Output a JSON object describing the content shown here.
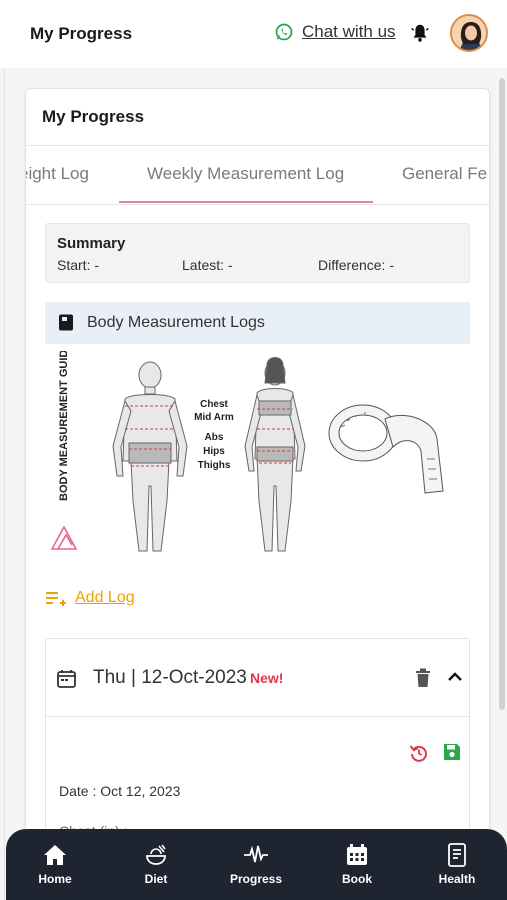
{
  "header": {
    "title": "My Progress",
    "chat_label": "Chat with us"
  },
  "card": {
    "title": "My Progress",
    "tabs": [
      {
        "label": "eight Log"
      },
      {
        "label": "Weekly Measurement Log",
        "active": true
      },
      {
        "label": "General Fe"
      }
    ]
  },
  "summary": {
    "title": "Summary",
    "start": "Start: -",
    "latest": "Latest: -",
    "difference": "Difference: -"
  },
  "logs_section": {
    "title": "Body Measurement Logs"
  },
  "guide_image": {
    "vertical_title": "BODY MEASUREMENT GUIDE",
    "labels": [
      "Chest",
      "Mid Arm",
      "Abs",
      "Hips",
      "Thighs"
    ]
  },
  "add_log": {
    "label": "Add Log"
  },
  "entry": {
    "date_header": "Thu | 12-Oct-2023",
    "badge": "New!",
    "date_line": "Date : Oct 12, 2023",
    "partial_line": "Chest (in) :"
  },
  "bottom_nav": [
    {
      "label": "Home",
      "icon": "home-icon"
    },
    {
      "label": "Diet",
      "icon": "diet-icon"
    },
    {
      "label": "Progress",
      "icon": "pulse-icon"
    },
    {
      "label": "Book",
      "icon": "calendar-icon"
    },
    {
      "label": "Health",
      "icon": "document-icon"
    }
  ],
  "colors": {
    "accent_tab": "#d98a9a",
    "add_log": "#f0a000",
    "new_badge": "#e3364b",
    "save_icon": "#2aa84a",
    "reset_icon": "#e3364b",
    "nav_bg": "#1e2530"
  }
}
